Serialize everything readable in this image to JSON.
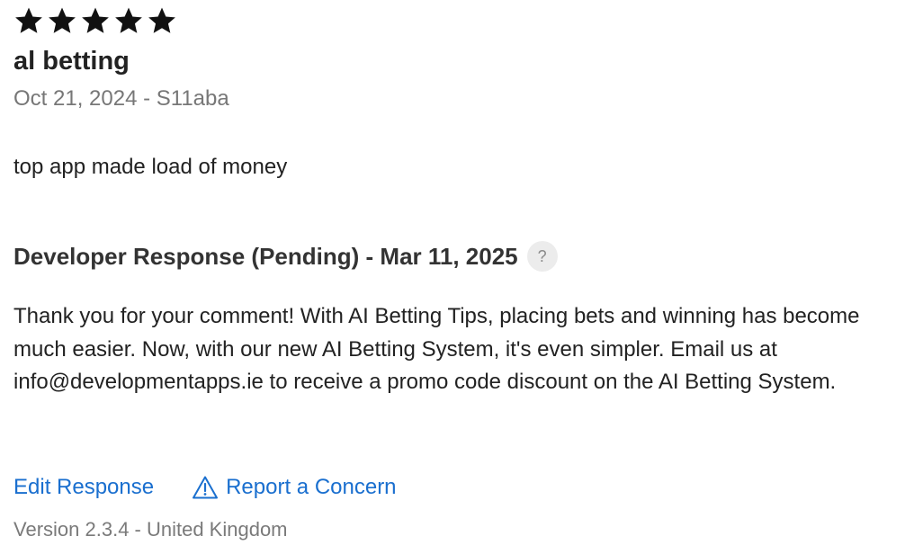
{
  "review": {
    "rating": 5,
    "max_rating": 5,
    "title": "al betting",
    "meta": "Oct 21, 2024 - S11aba",
    "body": "top app made load of money"
  },
  "developer_response": {
    "heading": "Developer Response (Pending) - Mar 11, 2025",
    "help_label": "?",
    "text": "Thank you for your comment! With AI Betting Tips, placing bets and winning has become much easier. Now, with our new AI Betting System, it's even simpler. Email us at info@developmentapps.ie to receive a promo code discount on the AI Betting System."
  },
  "actions": {
    "edit_label": "Edit Response",
    "report_label": "Report a Concern",
    "report_icon": "warning-triangle-icon"
  },
  "footer": {
    "version": "Version 2.3.4 - United Kingdom"
  },
  "colors": {
    "text": "#222222",
    "secondary": "#777777",
    "link": "#1a6fcf",
    "star": "#111111"
  }
}
